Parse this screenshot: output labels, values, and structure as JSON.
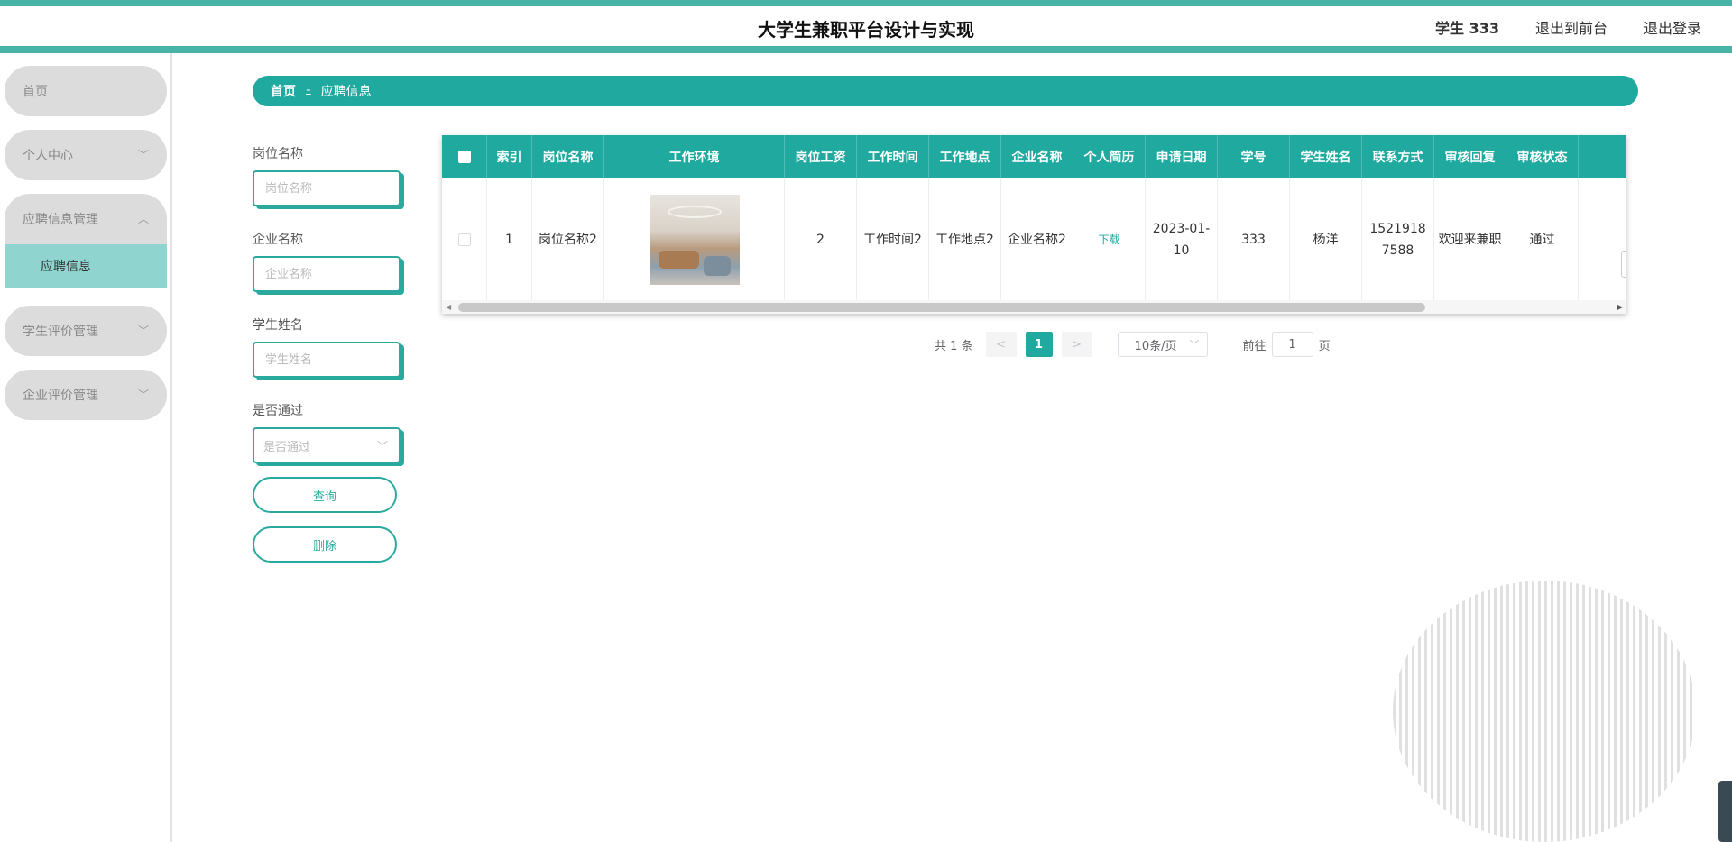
{
  "header": {
    "title": "大学生兼职平台设计与实现",
    "user": "学生 333",
    "exit_front": "退出到前台",
    "logout": "退出登录"
  },
  "sidebar": {
    "items": [
      {
        "label": "首页"
      },
      {
        "label": "个人中心"
      },
      {
        "label": "应聘信息管理"
      },
      {
        "label": "学生评价管理"
      },
      {
        "label": "企业评价管理"
      }
    ],
    "active_sub": "应聘信息"
  },
  "breadcrumb": {
    "home": "首页",
    "separator": "Ξ",
    "current": "应聘信息"
  },
  "search": {
    "job_label": "岗位名称",
    "job_placeholder": "岗位名称",
    "company_label": "企业名称",
    "company_placeholder": "企业名称",
    "student_label": "学生姓名",
    "student_placeholder": "学生姓名",
    "pass_label": "是否通过",
    "pass_placeholder": "是否通过",
    "query_button": "查询",
    "delete_button": "删除"
  },
  "table": {
    "headers": [
      "索引",
      "岗位名称",
      "工作环境",
      "岗位工资",
      "工作时间",
      "工作地点",
      "企业名称",
      "个人简历",
      "申请日期",
      "学号",
      "学生姓名",
      "联系方式",
      "审核回复",
      "审核状态"
    ],
    "row": {
      "index": "1",
      "job_name": "岗位名称2",
      "salary": "2",
      "work_time": "工作时间2",
      "location": "工作地点2",
      "company": "企业名称2",
      "resume_link": "下载",
      "apply_date": "2023-01-10",
      "student_id": "333",
      "student_name": "杨洋",
      "phone": "15219187588",
      "reply": "欢迎来兼职",
      "status": "通过"
    }
  },
  "pagination": {
    "total": "共 1 条",
    "prev": "<",
    "current_page": "1",
    "next": ">",
    "page_size": "10条/页",
    "goto_label": "前往",
    "goto_value": "1",
    "page_suffix": "页"
  },
  "icons": {
    "chevron": "chevron-down-icon",
    "chevron_up": "chevron-up-icon"
  },
  "colors": {
    "accent": "#1fa99f",
    "header_stripe": "#49b3a8"
  }
}
